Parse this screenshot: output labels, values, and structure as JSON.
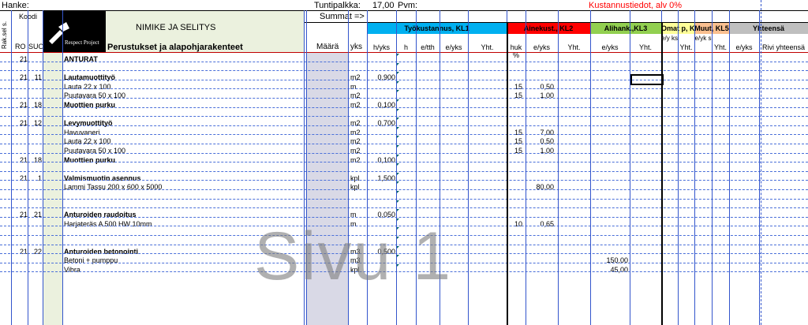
{
  "header": {
    "hanke_label": "Hanke:",
    "koodi_label": "Koodi",
    "rak_sel_label": "Rak.sel s.",
    "ro_label": "RO",
    "suo_label": "SUO",
    "logo_text": "Respect Project",
    "title_label": "NIMIKE JA SELITYS",
    "subtitle_label": "Perustukset ja alapohjarakenteet",
    "tuntipalkka_label": "Tuntipalkka:",
    "tuntipalkka_value": "17,00",
    "pvm_label": "Pvm:",
    "summat_label": "Summat =>",
    "kustannus_label": "Kustannustiedot,  alv 0%",
    "maara_label": "Määrä",
    "yks_label": "yks",
    "groups": [
      {
        "label": "Työkustannus, KL1",
        "color": "#00b0f0"
      },
      {
        "label": "Ainekust., KL2",
        "color": "#ff0000"
      },
      {
        "label": "Alihank.,KL3",
        "color": "#92d050"
      },
      {
        "label": "Omat p, KL",
        "color": "#ffff99"
      },
      {
        "label": "Muut, KL5",
        "color": "#fac090"
      },
      {
        "label": "Yhteensä",
        "color": "#bfbfbf"
      }
    ],
    "cols": [
      "h/yks",
      "h",
      "e/tth",
      "e/yks",
      "Yht.",
      "huk %",
      "e/yks",
      "Yht.",
      "e/yks",
      "Yht.",
      "e/y ks",
      "Yht.",
      "e/yk s",
      "Yht.",
      "e/yks",
      "Rivi yhteensä"
    ]
  },
  "rows": [
    {
      "ro": "21",
      "suo": "",
      "name": "ANTURAT",
      "bold": true,
      "unit": "",
      "hyks": "",
      "huk": "",
      "ayks": "",
      "ayht": "",
      "alyks": ""
    },
    {
      "ro": "",
      "suo": "",
      "name": "",
      "bold": false,
      "unit": "",
      "hyks": "",
      "huk": "",
      "ayks": "",
      "ayht": "",
      "alyks": ""
    },
    {
      "ro": "21",
      "suo": "11",
      "name": "Lautamuottityö",
      "bold": true,
      "unit": "m2",
      "hyks": "0,900",
      "huk": "",
      "ayks": "",
      "ayht": "",
      "alyks": ""
    },
    {
      "ro": "",
      "suo": "",
      "name": "Lauta 22 x 100",
      "bold": false,
      "unit": "m",
      "hyks": "",
      "huk": "15",
      "ayks": "0,50",
      "ayht": "",
      "alyks": ""
    },
    {
      "ro": "",
      "suo": "",
      "name": "Puutavara 50 x 100",
      "bold": false,
      "unit": "m2",
      "hyks": "",
      "huk": "15",
      "ayks": "1,00",
      "ayht": "",
      "alyks": ""
    },
    {
      "ro": "21",
      "suo": "18",
      "name": "Muottien purku",
      "bold": true,
      "unit": "m2",
      "hyks": "0,100",
      "huk": "",
      "ayks": "",
      "ayht": "",
      "alyks": ""
    },
    {
      "ro": "",
      "suo": "",
      "name": "",
      "bold": false,
      "unit": "",
      "hyks": "",
      "huk": "",
      "ayks": "",
      "ayht": "",
      "alyks": ""
    },
    {
      "ro": "21",
      "suo": "12",
      "name": "Levymuottityö",
      "bold": true,
      "unit": "m2",
      "hyks": "0,700",
      "huk": "",
      "ayks": "",
      "ayht": "",
      "alyks": ""
    },
    {
      "ro": "",
      "suo": "",
      "name": "Havuvaneri",
      "bold": false,
      "unit": "m2",
      "hyks": "",
      "huk": "15",
      "ayks": "7,00",
      "ayht": "",
      "alyks": ""
    },
    {
      "ro": "",
      "suo": "",
      "name": "Lauta 22 x 100",
      "bold": false,
      "unit": "m2",
      "hyks": "",
      "huk": "15",
      "ayks": "0,50",
      "ayht": "",
      "alyks": ""
    },
    {
      "ro": "",
      "suo": "",
      "name": "Puutavara 50 x 100",
      "bold": false,
      "unit": "m2",
      "hyks": "",
      "huk": "15",
      "ayks": "1,00",
      "ayht": "",
      "alyks": ""
    },
    {
      "ro": "21",
      "suo": "18",
      "name": "Muottien purku",
      "bold": true,
      "unit": "m2",
      "hyks": "0,100",
      "huk": "",
      "ayks": "",
      "ayht": "",
      "alyks": ""
    },
    {
      "ro": "",
      "suo": "",
      "name": "",
      "bold": false,
      "unit": "",
      "hyks": "",
      "huk": "",
      "ayks": "",
      "ayht": "",
      "alyks": ""
    },
    {
      "ro": "21",
      "suo": "1",
      "name": "Valmismuotin asennus",
      "bold": true,
      "unit": "kpl",
      "hyks": "1,500",
      "huk": "",
      "ayks": "",
      "ayht": "",
      "alyks": ""
    },
    {
      "ro": "",
      "suo": "",
      "name": "Lammi Tassu 200 x 600 x 5000",
      "bold": false,
      "unit": "kpl",
      "hyks": "",
      "huk": "",
      "ayks": "",
      "ayht": "80,00",
      "alyks": ""
    },
    {
      "ro": "",
      "suo": "",
      "name": "",
      "bold": false,
      "unit": "",
      "hyks": "",
      "huk": "",
      "ayks": "",
      "ayht": "",
      "alyks": ""
    },
    {
      "ro": "",
      "suo": "",
      "name": "",
      "bold": false,
      "unit": "",
      "hyks": "",
      "huk": "",
      "ayks": "",
      "ayht": "",
      "alyks": ""
    },
    {
      "ro": "21",
      "suo": "21",
      "name": "Anturoiden raudoitus",
      "bold": true,
      "unit": "m",
      "hyks": "0,050",
      "huk": "",
      "ayks": "",
      "ayht": "",
      "alyks": ""
    },
    {
      "ro": "",
      "suo": "",
      "name": "Harjateräs A 500 HW 10mm",
      "bold": false,
      "unit": "m",
      "hyks": "",
      "huk": "10",
      "ayks": "0,65",
      "ayht": "",
      "alyks": ""
    },
    {
      "ro": "",
      "suo": "",
      "name": "",
      "bold": false,
      "unit": "",
      "hyks": "",
      "huk": "",
      "ayks": "",
      "ayht": "",
      "alyks": ""
    },
    {
      "ro": "",
      "suo": "",
      "name": "",
      "bold": false,
      "unit": "",
      "hyks": "",
      "huk": "",
      "ayks": "",
      "ayht": "",
      "alyks": ""
    },
    {
      "ro": "21",
      "suo": "22",
      "name": "Anturoiden betonointi",
      "bold": true,
      "unit": "m3",
      "hyks": "0,500",
      "huk": "",
      "ayks": "",
      "ayht": "",
      "alyks": ""
    },
    {
      "ro": "",
      "suo": "",
      "name": "Betoni + pumppu",
      "bold": false,
      "unit": "m3",
      "hyks": "",
      "huk": "",
      "ayks": "",
      "ayht": "",
      "alyks": "150,00"
    },
    {
      "ro": "",
      "suo": "",
      "name": "Vibra",
      "bold": false,
      "unit": "kpl",
      "hyks": "",
      "huk": "",
      "ayks": "",
      "ayht": "",
      "alyks": "45,00"
    }
  ],
  "watermark": "Sivu 1"
}
